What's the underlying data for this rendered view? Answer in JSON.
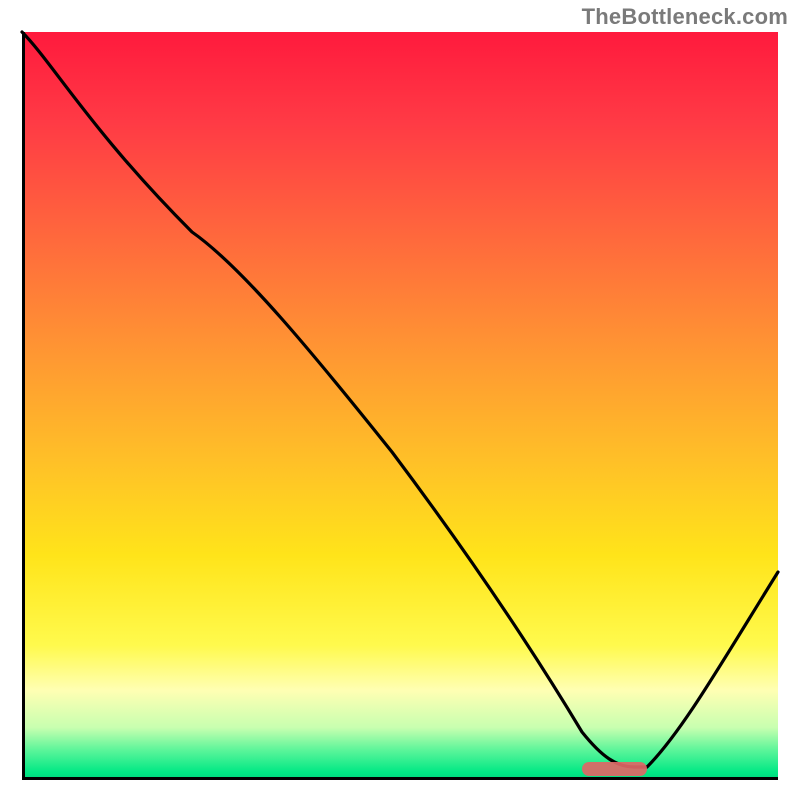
{
  "watermark": "TheBottleneck.com",
  "chart_data": {
    "type": "line",
    "title": "",
    "xlabel": "",
    "ylabel": "",
    "xlim": [
      0,
      100
    ],
    "ylim": [
      0,
      100
    ],
    "grid": false,
    "legend": false,
    "x": [
      0,
      5,
      15,
      25,
      35,
      45,
      55,
      65,
      72,
      77,
      81,
      100
    ],
    "y": [
      100,
      95,
      80,
      72,
      58,
      44,
      30,
      16,
      5,
      2,
      2,
      28
    ],
    "marker": {
      "x_range": [
        74,
        82
      ],
      "y": 2,
      "color": "#e06666"
    },
    "gradient_colors": {
      "top": "#ff1a3d",
      "mid_high": "#ff9433",
      "mid_low": "#ffe41a",
      "bottom": "#00d47c"
    }
  }
}
